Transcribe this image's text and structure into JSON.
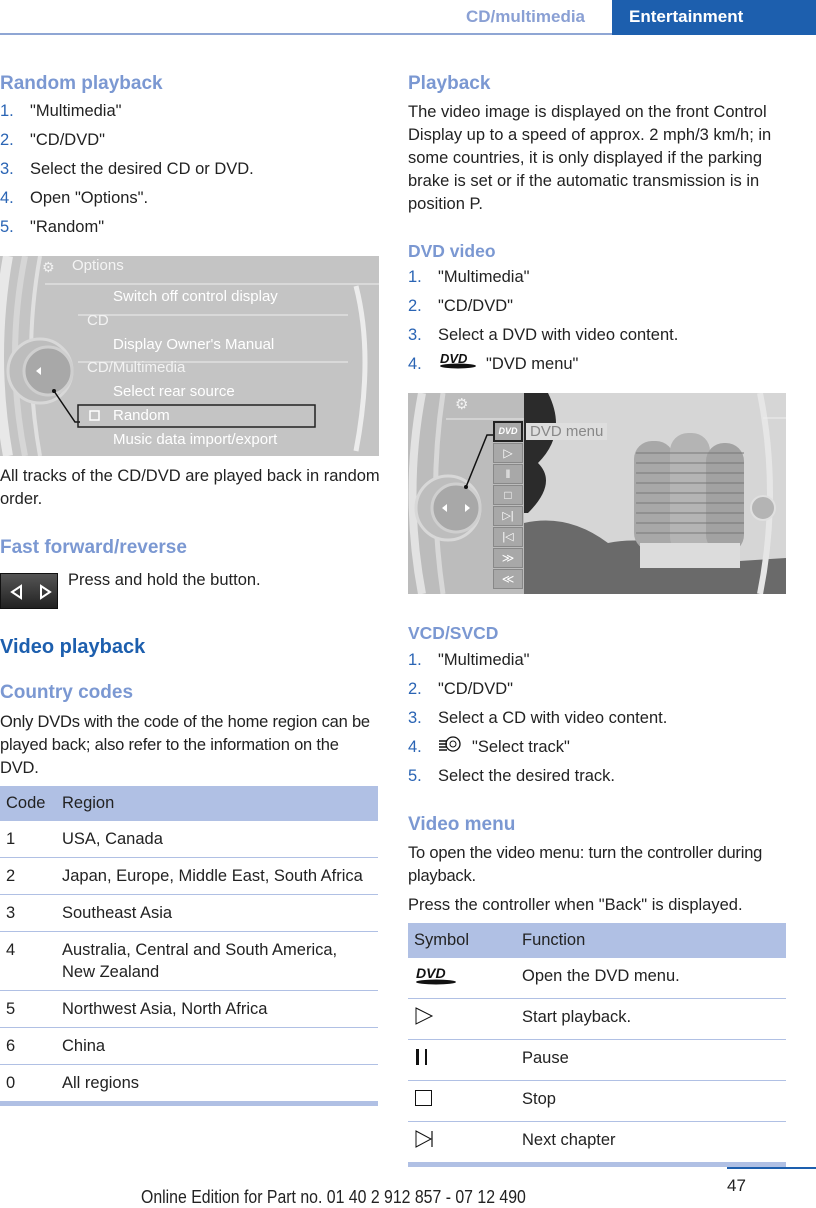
{
  "header": {
    "section": "CD/multimedia",
    "chapter": "Entertainment"
  },
  "left": {
    "random_playback": {
      "title": "Random playback",
      "steps": [
        {
          "num": "1.",
          "text": "\"Multimedia\""
        },
        {
          "num": "2.",
          "text": "\"CD/DVD\""
        },
        {
          "num": "3.",
          "text": "Select the desired CD or DVD."
        },
        {
          "num": "4.",
          "text": "Open \"Options\"."
        },
        {
          "num": "5.",
          "text": "\"Random\""
        }
      ],
      "screen": {
        "title": "Options",
        "items": [
          {
            "text": "Switch off control display",
            "type": "item"
          },
          {
            "text": "CD",
            "type": "group"
          },
          {
            "text": "Display Owner's Manual",
            "type": "item"
          },
          {
            "text": "CD/Multimedia",
            "type": "group"
          },
          {
            "text": "Select rear source",
            "type": "item"
          },
          {
            "text": "Random",
            "type": "checkbox",
            "checked": false,
            "highlighted": true
          },
          {
            "text": "Music data import/export",
            "type": "item"
          }
        ]
      },
      "description": "All tracks of the CD/DVD are played back in random order."
    },
    "fast_forward": {
      "title": "Fast forward/reverse",
      "text": "Press and hold the button."
    },
    "video_playback": {
      "title": "Video playback"
    },
    "country_codes": {
      "title": "Country codes",
      "text": "Only DVDs with the code of the home region can be played back; also refer to the information on the DVD.",
      "table": {
        "headers": [
          "Code",
          "Region"
        ],
        "rows": [
          [
            "1",
            "USA, Canada"
          ],
          [
            "2",
            "Japan, Europe, Middle East, South Africa"
          ],
          [
            "3",
            "Southeast Asia"
          ],
          [
            "4",
            "Australia, Central and South America, New Zealand"
          ],
          [
            "5",
            "Northwest Asia, North Africa"
          ],
          [
            "6",
            "China"
          ],
          [
            "0",
            "All regions"
          ]
        ]
      }
    }
  },
  "right": {
    "playback": {
      "title": "Playback",
      "text": "The video image is displayed on the front Control Display up to a speed of approx. 2 mph/3 km/h; in some countries, it is only displayed if the parking brake is set or if the automatic transmission is in position P."
    },
    "dvd_video": {
      "title": "DVD video",
      "steps": [
        {
          "num": "1.",
          "text": "\"Multimedia\""
        },
        {
          "num": "2.",
          "text": "\"CD/DVD\""
        },
        {
          "num": "3.",
          "text": "Select a DVD with video content."
        },
        {
          "num": "4.",
          "text": "\"DVD menu\"",
          "icon": "dvd-icon"
        }
      ],
      "screen": {
        "tooltip": "DVD menu",
        "buttons": [
          "dvd-menu",
          "play",
          "pause",
          "stop",
          "next-chapter",
          "previous-chapter",
          "fast-forward",
          "rewind"
        ]
      }
    },
    "vcd": {
      "title": "VCD/SVCD",
      "steps": [
        {
          "num": "1.",
          "text": "\"Multimedia\""
        },
        {
          "num": "2.",
          "text": "\"CD/DVD\""
        },
        {
          "num": "3.",
          "text": "Select a CD with video content."
        },
        {
          "num": "4.",
          "text": "\"Select track\"",
          "icon": "select-track-icon"
        },
        {
          "num": "5.",
          "text": "Select the desired track."
        }
      ]
    },
    "video_menu": {
      "title": "Video menu",
      "text1": "To open the video menu: turn the controller during playback.",
      "text2": "Press the controller when \"Back\" is displayed.",
      "table": {
        "headers": [
          "Symbol",
          "Function"
        ],
        "rows": [
          {
            "symbol": "dvd-icon",
            "function": "Open the DVD menu."
          },
          {
            "symbol": "play-icon",
            "function": "Start playback."
          },
          {
            "symbol": "pause-icon",
            "function": "Pause"
          },
          {
            "symbol": "stop-icon",
            "function": "Stop"
          },
          {
            "symbol": "next-chapter-icon",
            "function": "Next chapter"
          }
        ]
      }
    }
  },
  "footer": {
    "page": "47",
    "edition": "Online Edition for Part no. 01 40 2 912 857 - 07 12 490"
  },
  "colors": {
    "brand_blue": "#1d5fae",
    "heading_light_blue": "#7b98d2",
    "table_header": "#b0c0e4"
  }
}
